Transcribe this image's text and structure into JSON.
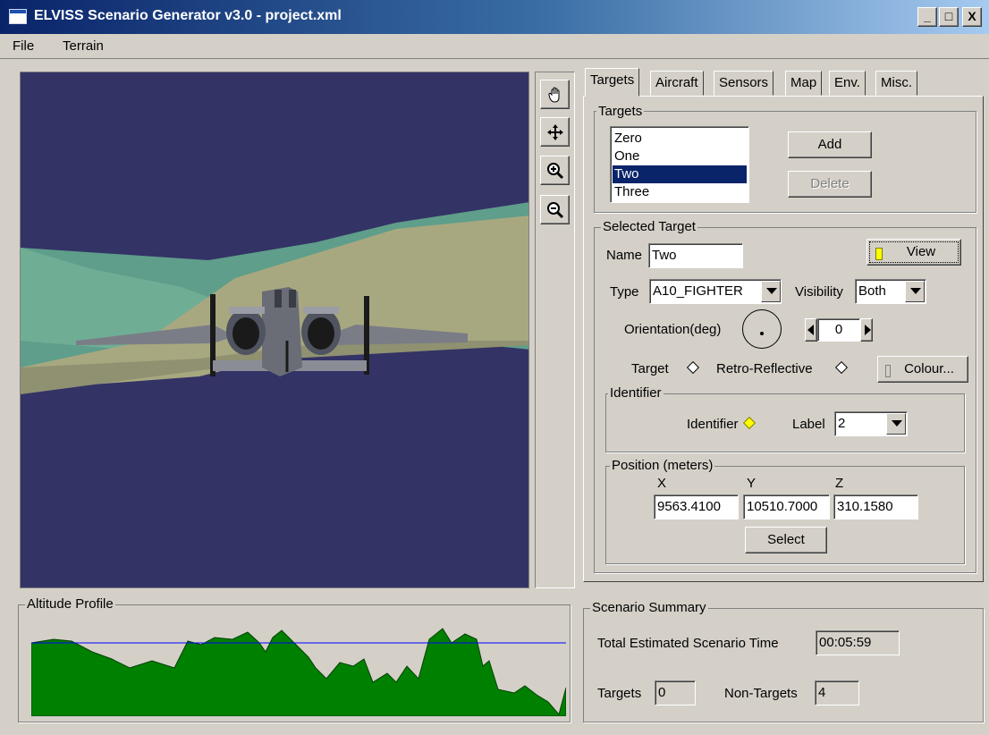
{
  "window": {
    "title": "ELVISS Scenario Generator v3.0 - project.xml",
    "minimize": "_",
    "maximize": "□",
    "close": "X"
  },
  "menu": {
    "file": "File",
    "terrain": "Terrain"
  },
  "tools": [
    "hand-pan-icon",
    "move-arrows-icon",
    "zoom-in-icon",
    "zoom-out-icon"
  ],
  "tabs": [
    "Targets",
    "Aircraft",
    "Sensors",
    "Map",
    "Env.",
    "Misc."
  ],
  "targets_group": {
    "title": "Targets",
    "items": [
      "Zero",
      "One",
      "Two",
      "Three"
    ],
    "selected": "Two",
    "add_label": "Add",
    "delete_label": "Delete"
  },
  "selected_target": {
    "title": "Selected Target",
    "name_label": "Name",
    "name_value": "Two",
    "view_label": "View",
    "type_label": "Type",
    "type_value": "A10_FIGHTER",
    "visibility_label": "Visibility",
    "visibility_value": "Both",
    "orientation_label": "Orientation(deg)",
    "orientation_value": "0",
    "target_label": "Target",
    "retro_label": "Retro-Reflective",
    "colour_label": "Colour...",
    "identifier": {
      "title": "Identifier",
      "identifier_label": "Identifier",
      "label_label": "Label",
      "label_value": "2"
    },
    "position": {
      "title": "Position (meters)",
      "x_label": "X",
      "y_label": "Y",
      "z_label": "Z",
      "x_value": "9563.4100",
      "y_value": "10510.7000",
      "z_value": "310.1580",
      "select_label": "Select"
    }
  },
  "altitude_profile": {
    "title": "Altitude Profile"
  },
  "scenario_summary": {
    "title": "Scenario Summary",
    "time_label": "Total Estimated Scenario Time",
    "time_value": "00:05:59",
    "targets_label": "Targets",
    "targets_value": "0",
    "non_targets_label": "Non-Targets",
    "non_targets_value": "4"
  },
  "colors": {
    "sky": "#333366",
    "title_bar": "#0a246a",
    "selection": "#0a246a",
    "profile_fill": "#008000",
    "profile_line": "#0000ff"
  }
}
